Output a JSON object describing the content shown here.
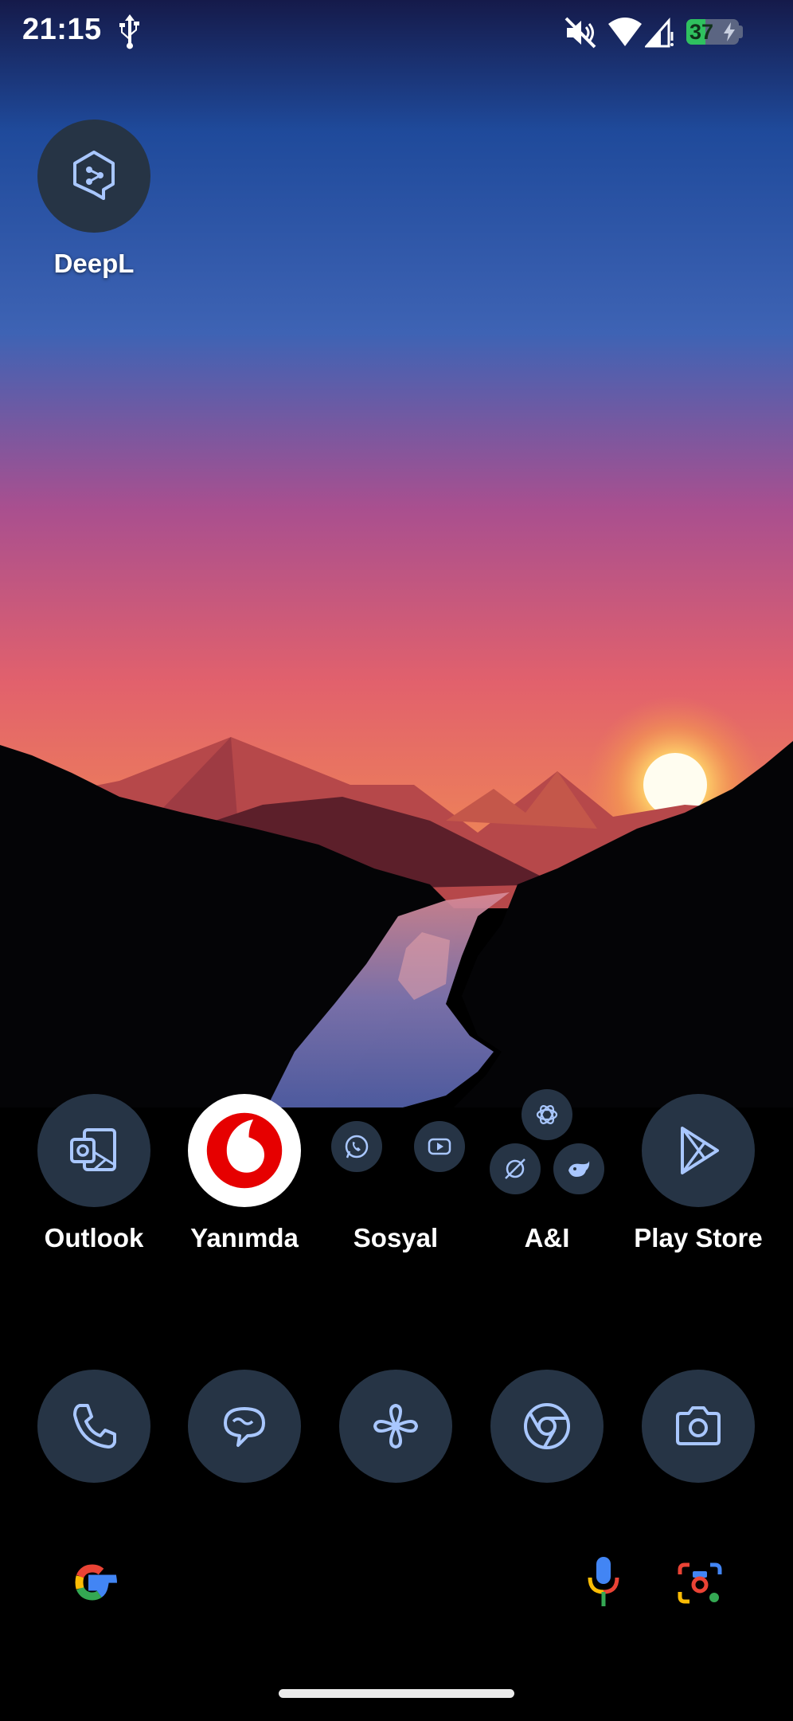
{
  "status_bar": {
    "time": "21:15",
    "battery_percent": "37",
    "battery_level": 0.37,
    "icons": [
      "usb-icon",
      "mute-icon",
      "wifi-icon",
      "signal-icon",
      "battery-charging-icon"
    ]
  },
  "home_apps": {
    "deepl": {
      "label": "DeepL",
      "icon": "deepl-icon"
    }
  },
  "row1": [
    {
      "label": "Outlook",
      "icon": "outlook-icon"
    },
    {
      "label": "Yanımda",
      "icon": "vodafone-icon"
    },
    {
      "label": "Sosyal",
      "icon": "folder",
      "contents": [
        "whatsapp-icon",
        "youtube-icon"
      ]
    },
    {
      "label": "A&I",
      "icon": "folder",
      "contents": [
        "chatgpt-icon",
        "perplexity-icon",
        "deepseek-icon"
      ]
    },
    {
      "label": "Play Store",
      "icon": "play-store-icon"
    }
  ],
  "dock": [
    {
      "icon": "phone-icon"
    },
    {
      "icon": "messages-icon"
    },
    {
      "icon": "pinwheel-icon"
    },
    {
      "icon": "chrome-icon"
    },
    {
      "icon": "camera-icon"
    }
  ],
  "search_bar": {
    "icons": [
      "google-g-icon",
      "microphone-icon",
      "google-lens-icon"
    ]
  },
  "colors": {
    "icon_bg": "#263445",
    "icon_fg": "#a9c7ff",
    "battery_fill": "#2fc15f",
    "vodafone_red": "#e60000"
  }
}
